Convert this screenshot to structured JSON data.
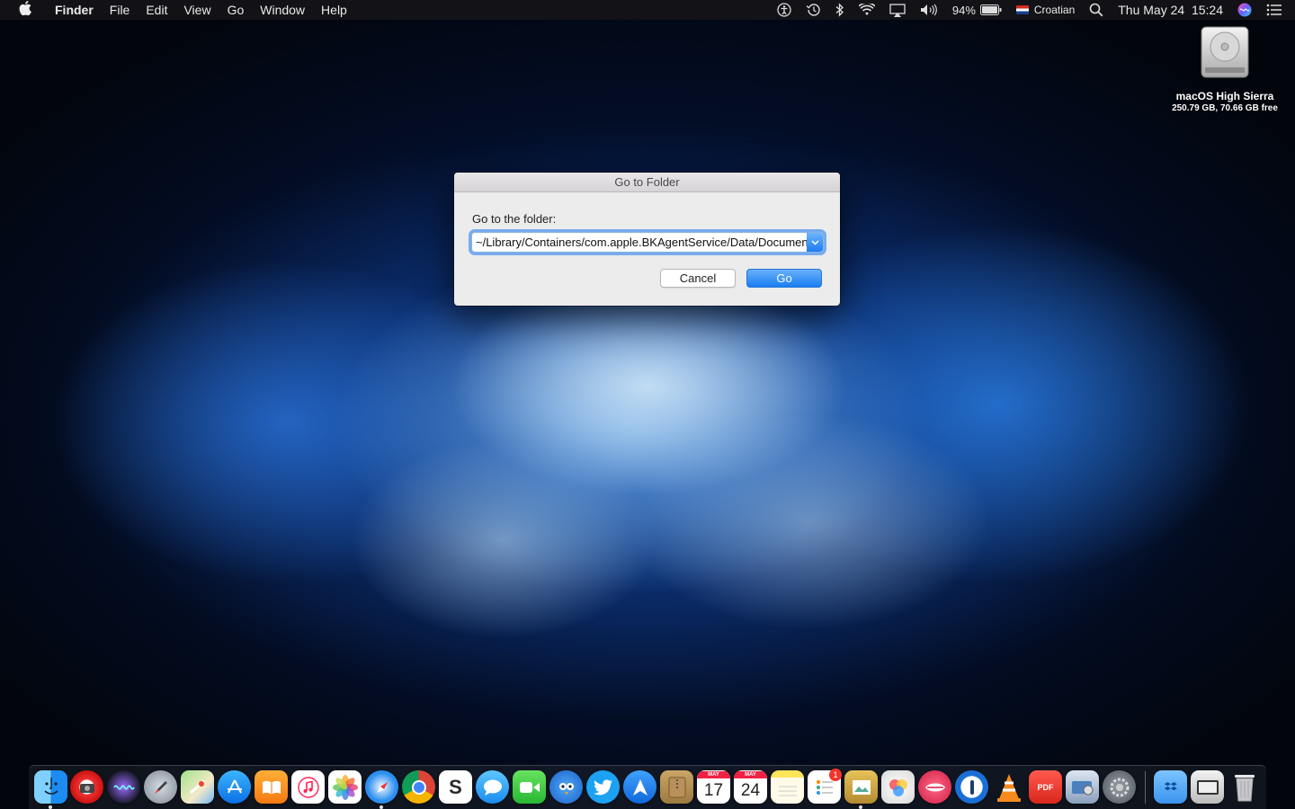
{
  "menubar": {
    "app_name": "Finder",
    "menus": [
      "File",
      "Edit",
      "View",
      "Go",
      "Window",
      "Help"
    ],
    "battery": "94%",
    "input_source": "Croatian",
    "clock": "Thu May 24  15:24"
  },
  "desktop": {
    "drive_name": "macOS High Sierra",
    "drive_info": "250.79 GB, 70.66 GB free"
  },
  "dialog": {
    "title": "Go to Folder",
    "prompt": "Go to the folder:",
    "path_value": "~/Library/Containers/com.apple.BKAgentService/Data/Documents",
    "cancel_label": "Cancel",
    "go_label": "Go"
  },
  "dock": {
    "calendar_day_1": "17",
    "calendar_day_2": "24",
    "calendar_month": "MAY",
    "reminders_badge": "1",
    "pdf_label": "PDF"
  }
}
